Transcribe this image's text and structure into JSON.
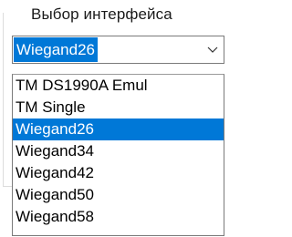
{
  "group": {
    "label": "Выбор интерфейса"
  },
  "combo": {
    "selected_value": "Wiegand26",
    "arrow_icon": "chevron-down-icon"
  },
  "dropdown": {
    "options": [
      {
        "label": "TM DS1990A Emul",
        "selected": false
      },
      {
        "label": "TM Single",
        "selected": false
      },
      {
        "label": "Wiegand26",
        "selected": true
      },
      {
        "label": "Wiegand34",
        "selected": false
      },
      {
        "label": "Wiegand42",
        "selected": false
      },
      {
        "label": "Wiegand50",
        "selected": false
      },
      {
        "label": "Wiegand58",
        "selected": false
      }
    ]
  },
  "colors": {
    "selection": "#0078d7",
    "border": "#7a7a7a"
  }
}
